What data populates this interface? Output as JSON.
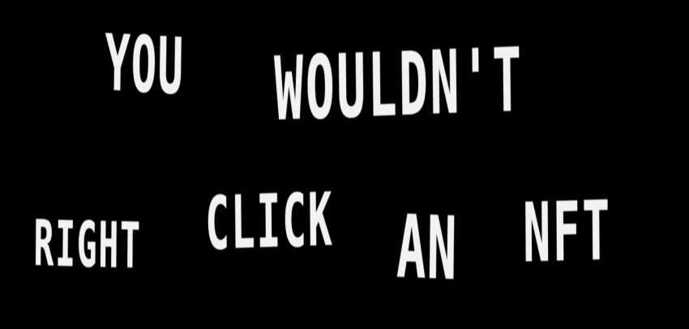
{
  "background_color": "#000000",
  "text_color": "#f2f2f2",
  "lines": [
    {
      "words": [
        "YOU",
        "WOULDN'T"
      ]
    },
    {
      "words": [
        "RIGHT",
        "CLICK",
        "AN",
        "NFT"
      ]
    }
  ]
}
